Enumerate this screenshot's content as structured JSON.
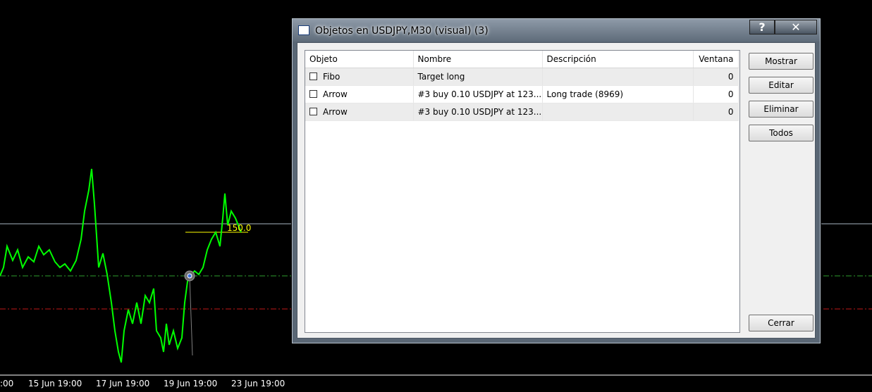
{
  "window": {
    "title": "Objetos en USDJPY,M30 (visual) (3)",
    "help_label": "?",
    "close_label": "✕"
  },
  "list": {
    "columns": [
      "Objeto",
      "Nombre",
      "Descripción",
      "Ventana"
    ],
    "rows": [
      {
        "objeto": "Fibo",
        "nombre": "Target long",
        "descripcion": "",
        "ventana": "0"
      },
      {
        "objeto": "Arrow",
        "nombre": "#3 buy 0.10 USDJPY at 123....",
        "descripcion": "Long trade (8969)",
        "ventana": "0"
      },
      {
        "objeto": "Arrow",
        "nombre": "#3 buy 0.10 USDJPY at 123....",
        "descripcion": "",
        "ventana": "0"
      }
    ]
  },
  "buttons": {
    "mostrar": "Mostrar",
    "editar": "Editar",
    "eliminar": "Eliminar",
    "todos": "Todos",
    "cerrar": "Cerrar"
  },
  "chart": {
    "fibo_label": "150.0",
    "x_labels": [
      ":00",
      "15 Jun 19:00",
      "17 Jun 19:00",
      "19 Jun 19:00",
      "23 Jun 19:00"
    ],
    "colors": {
      "background": "#000000",
      "price_line": "#00ff00",
      "green_level": "#2e9e2e",
      "red_level": "#c01818",
      "fibo": "#ffff00",
      "axis_text": "#ffffff"
    }
  }
}
